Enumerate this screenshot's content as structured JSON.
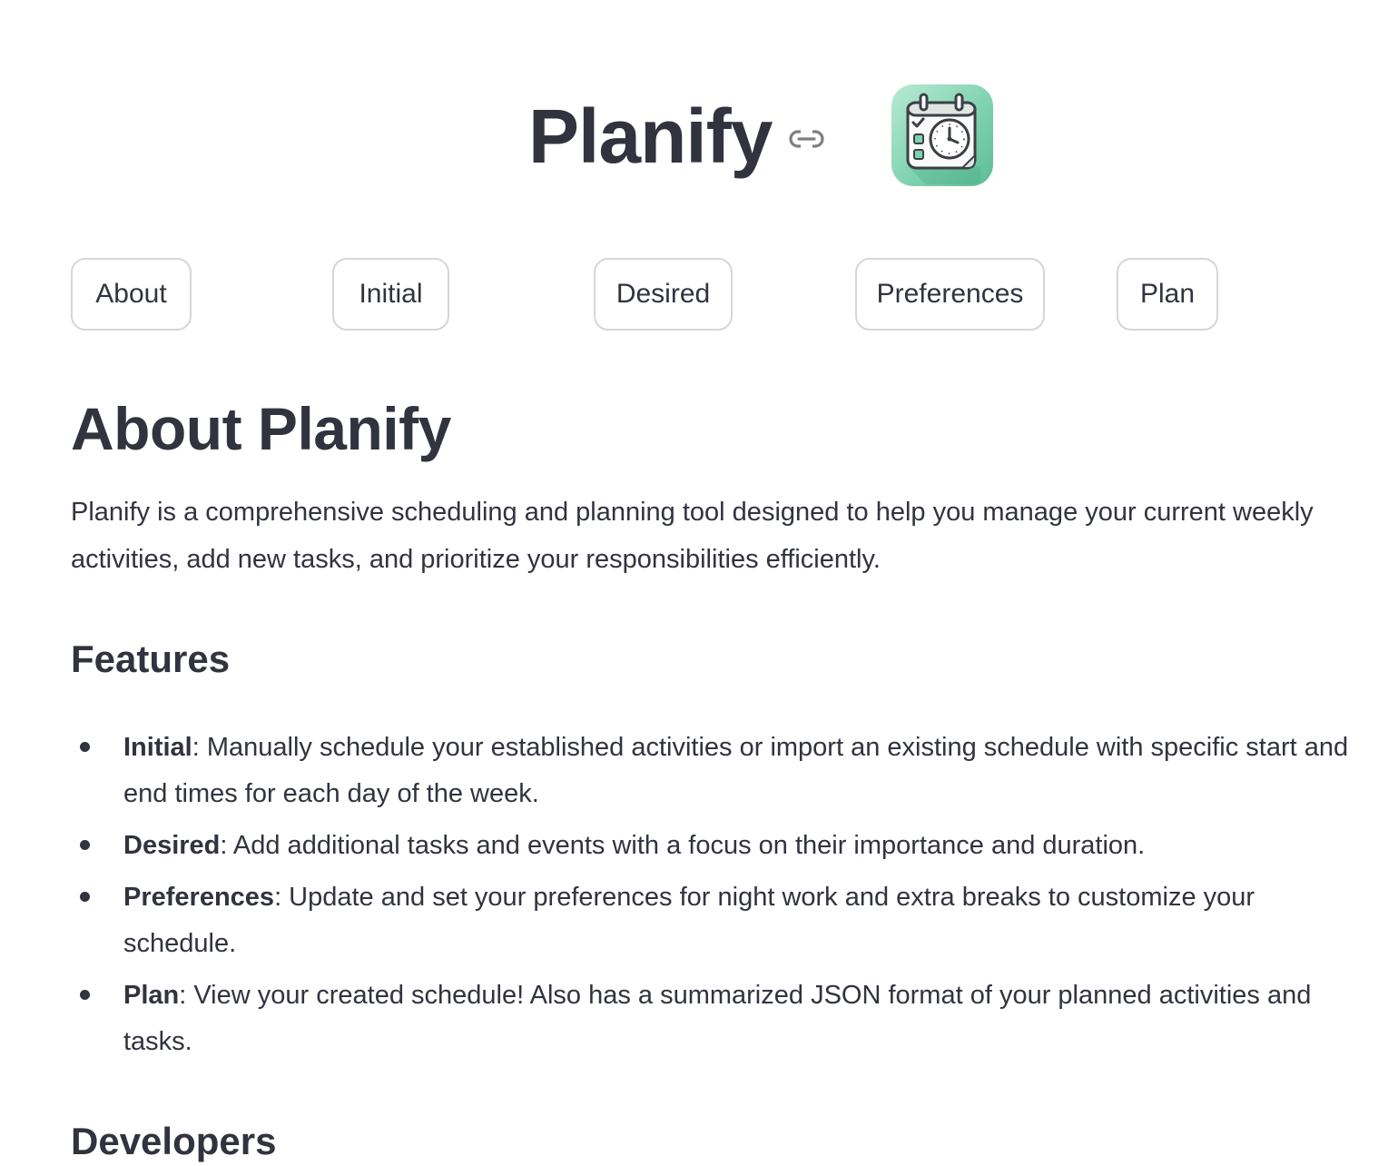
{
  "app": {
    "title": "Planify",
    "logo_icon": "calendar-clock-checklist-icon",
    "accent_color": "#7fd3b0"
  },
  "nav": {
    "buttons": [
      {
        "label": "About"
      },
      {
        "label": "Initial"
      },
      {
        "label": "Desired"
      },
      {
        "label": "Preferences"
      },
      {
        "label": "Plan"
      }
    ]
  },
  "about": {
    "heading": "About Planify",
    "intro": "Planify is a comprehensive scheduling and planning tool designed to help you manage your current weekly activities, add new tasks, and prioritize your responsibilities efficiently.",
    "features_heading": "Features",
    "features": [
      {
        "name": "Initial",
        "description": ": Manually schedule your established activities or import an existing schedule with specific start and end times for each day of the week."
      },
      {
        "name": "Desired",
        "description": ": Add additional tasks and events with a focus on their importance and duration."
      },
      {
        "name": "Preferences",
        "description": ": Update and set your preferences for night work and extra breaks to customize your schedule."
      },
      {
        "name": "Plan",
        "description": ": View your created schedule! Also has a summarized JSON format of your planned activities and tasks."
      }
    ],
    "developers_heading": "Developers"
  }
}
